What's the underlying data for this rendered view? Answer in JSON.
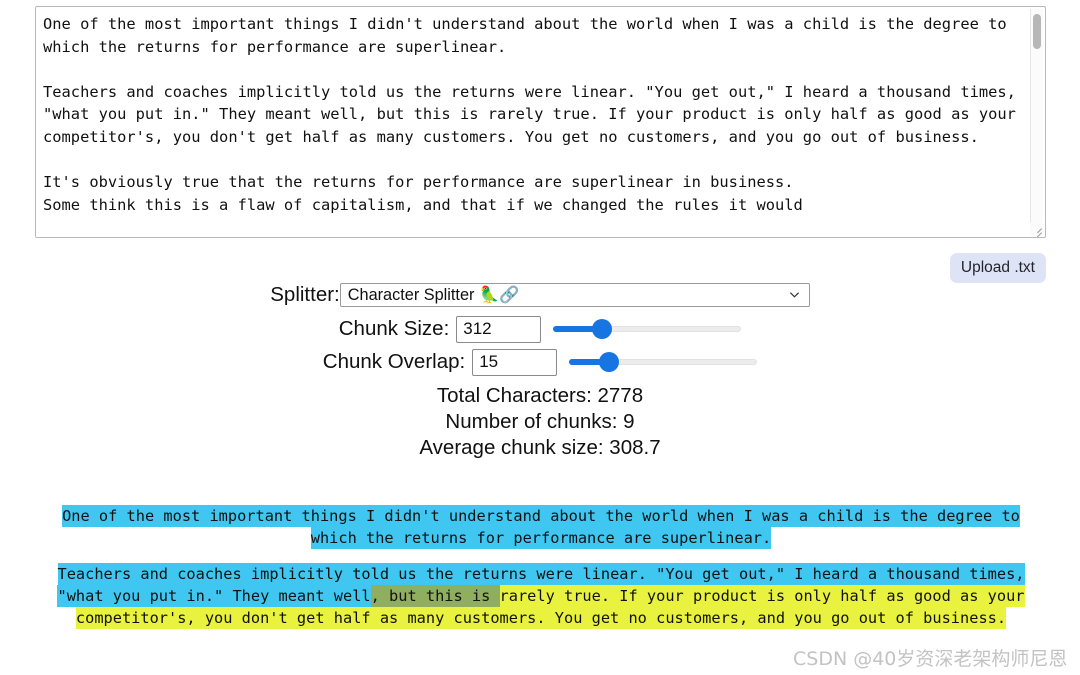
{
  "source_textarea": {
    "value": "One of the most important things I didn't understand about the world when I was a child is the degree to which the returns for performance are superlinear.\n\nTeachers and coaches implicitly told us the returns were linear. \"You get out,\" I heard a thousand times, \"what you put in.\" They meant well, but this is rarely true. If your product is only half as good as your competitor's, you don't get half as many customers. You get no customers, and you go out of business.\n\nIt's obviously true that the returns for performance are superlinear in business.\nSome think this is a flaw of capitalism, and that if we changed the rules it would"
  },
  "upload": {
    "label": "Upload .txt"
  },
  "controls": {
    "splitter": {
      "label": "Splitter:",
      "selected": "Character Splitter 🦜🔗",
      "options": [
        "Character Splitter 🦜🔗"
      ],
      "caret_icon": "chevron-down-icon"
    },
    "chunk_size": {
      "label": "Chunk Size:",
      "value": "312",
      "slider_percent": 26
    },
    "chunk_overlap": {
      "label": "Chunk Overlap:",
      "value": "15",
      "slider_percent": 21
    },
    "slider_color": "#1675e0"
  },
  "stats": {
    "total_characters": "Total Characters: 2778",
    "number_of_chunks": "Number of chunks: 9",
    "average_chunk_size": "Average chunk size: 308.7"
  },
  "highlight_colors": {
    "cyan": "#3fc7f2",
    "yellow": "#e9f23e",
    "overlap": "#8fae5e"
  },
  "chunks": [
    {
      "segments": [
        {
          "text": "One of the most important things I didn't understand about the world when I was a child is the degree to which the returns for performance are superlinear.",
          "style": "cyan"
        }
      ]
    },
    {
      "segments": [
        {
          "text": "Teachers and coaches implicitly told us the returns were linear. \"You get out,\" I heard a thousand times, \"what you put in.\" They meant well",
          "style": "cyan"
        },
        {
          "text": ", but this is ",
          "style": "overlap"
        },
        {
          "text": "rarely true. If your product is only half as good as your competitor's, you don't get half as many customers. You get no customers, and you go out of business.",
          "style": "yellow"
        }
      ]
    }
  ],
  "watermark": {
    "text": "CSDN @40岁资深老架构师尼恩"
  }
}
